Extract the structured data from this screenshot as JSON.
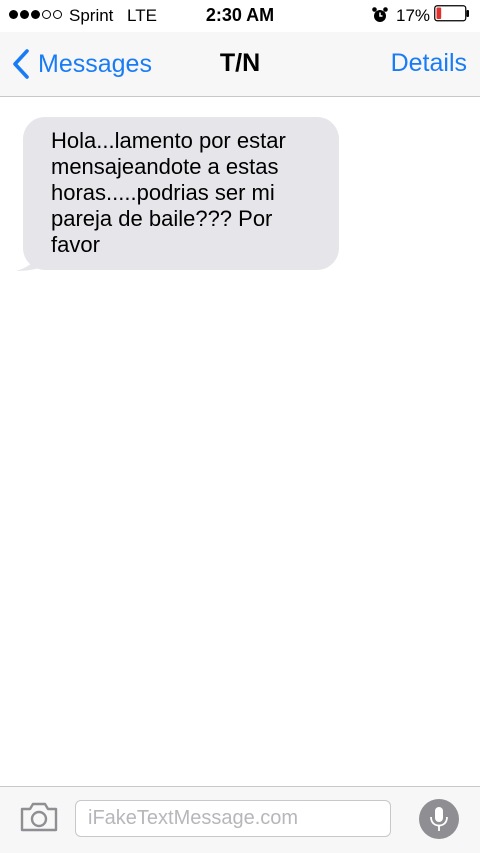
{
  "status_bar": {
    "signal_bars_filled": 3,
    "signal_bars_total": 5,
    "carrier": "Sprint",
    "network": "LTE",
    "time": "2:30 AM",
    "battery_percent": "17%",
    "battery_level": 0.17,
    "battery_color": "#e0312e",
    "icons": [
      "signal-dots-icon",
      "alarm-clock-icon",
      "battery-icon"
    ]
  },
  "nav": {
    "back_label": "Messages",
    "title": "T/N",
    "details_label": "Details",
    "accent_color": "#1a7cf5"
  },
  "conversation": {
    "messages": [
      {
        "direction": "received",
        "text": "Hola...lamento por estar mensajeandote a estas horas.....podrias ser mi pareja de baile??? Por favor",
        "bubble_color": "#e5e5ea"
      }
    ]
  },
  "input_bar": {
    "placeholder": "iFakeTextMessage.com",
    "value": "",
    "icons": [
      "camera-icon",
      "microphone-icon"
    ]
  }
}
